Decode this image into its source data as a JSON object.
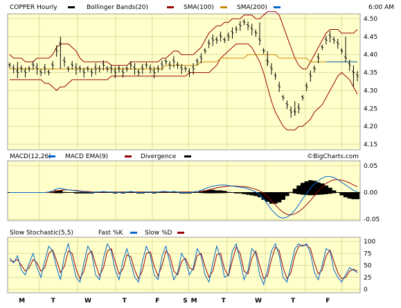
{
  "header": {
    "symbol_label": "COPPER Hourly",
    "bb_label": "Bollinger Bands(20)",
    "sma100_label": "SMA(100)",
    "sma200_label": "SMA(200)",
    "time_label": "6:00 AM"
  },
  "macd_header": {
    "macd_label": "MACD(12,26)",
    "ema_label": "MACD EMA(9)",
    "div_label": "Divergence",
    "watermark": "©BigCharts.com"
  },
  "stoch_header": {
    "title": "Slow Stochastic(5,5)",
    "fastk_label": "Fast %K",
    "slowd_label": "Slow %D"
  },
  "colors": {
    "panel_bg": "#ffffcc",
    "bb": "#990000",
    "sma100": "#cc8800",
    "sma200": "#0066cc",
    "macd": "#0066cc",
    "macd_ema": "#990000",
    "stoch_k": "#0066cc",
    "stoch_d": "#990000"
  },
  "chart_data": {
    "type": "stock_hourly_with_indicators",
    "x_day_labels": [
      "M",
      "T",
      "W",
      "T",
      "F",
      "S",
      "M",
      "T",
      "W",
      "T",
      "F"
    ],
    "price": {
      "ylim": [
        4.15,
        4.5
      ],
      "y_ticks": [
        "4.50",
        "4.45",
        "4.40",
        "4.35",
        "4.30",
        "4.25",
        "4.20",
        "4.15"
      ],
      "close": [
        4.37,
        4.36,
        4.35,
        4.36,
        4.35,
        4.36,
        4.37,
        4.36,
        4.35,
        4.36,
        4.35,
        4.37,
        4.41,
        4.43,
        4.38,
        4.36,
        4.37,
        4.36,
        4.36,
        4.35,
        4.36,
        4.35,
        4.36,
        4.36,
        4.37,
        4.36,
        4.36,
        4.35,
        4.36,
        4.35,
        4.36,
        4.37,
        4.36,
        4.35,
        4.36,
        4.37,
        4.36,
        4.35,
        4.36,
        4.37,
        4.38,
        4.37,
        4.38,
        4.37,
        4.36,
        4.36,
        4.35,
        4.36,
        4.38,
        4.39,
        4.41,
        4.43,
        4.44,
        4.44,
        4.45,
        4.44,
        4.45,
        4.46,
        4.47,
        4.48,
        4.49,
        4.48,
        4.47,
        4.46,
        4.44,
        4.41,
        4.38,
        4.36,
        4.34,
        4.31,
        4.28,
        4.26,
        4.24,
        4.24,
        4.25,
        4.28,
        4.31,
        4.34,
        4.36,
        4.39,
        4.42,
        4.44,
        4.45,
        4.44,
        4.43,
        4.41,
        4.39,
        4.37,
        4.35,
        4.34
      ],
      "bb_upper": [
        4.4,
        4.39,
        4.39,
        4.39,
        4.38,
        4.38,
        4.38,
        4.39,
        4.39,
        4.39,
        4.39,
        4.4,
        4.42,
        4.43,
        4.43,
        4.43,
        4.42,
        4.41,
        4.39,
        4.38,
        4.38,
        4.38,
        4.38,
        4.38,
        4.38,
        4.38,
        4.37,
        4.37,
        4.37,
        4.37,
        4.37,
        4.38,
        4.38,
        4.38,
        4.38,
        4.38,
        4.38,
        4.38,
        4.38,
        4.39,
        4.39,
        4.4,
        4.41,
        4.41,
        4.4,
        4.4,
        4.4,
        4.4,
        4.41,
        4.42,
        4.44,
        4.46,
        4.47,
        4.48,
        4.48,
        4.49,
        4.49,
        4.5,
        4.5,
        4.5,
        4.51,
        4.51,
        4.51,
        4.5,
        4.5,
        4.51,
        4.52,
        4.52,
        4.52,
        4.51,
        4.48,
        4.45,
        4.42,
        4.39,
        4.37,
        4.36,
        4.36,
        4.38,
        4.4,
        4.42,
        4.44,
        4.46,
        4.47,
        4.47,
        4.47,
        4.46,
        4.46,
        4.46,
        4.46,
        4.47
      ],
      "bb_lower": [
        4.33,
        4.33,
        4.33,
        4.33,
        4.33,
        4.33,
        4.33,
        4.33,
        4.33,
        4.32,
        4.32,
        4.31,
        4.3,
        4.31,
        4.31,
        4.32,
        4.33,
        4.33,
        4.33,
        4.33,
        4.33,
        4.33,
        4.33,
        4.33,
        4.33,
        4.33,
        4.34,
        4.34,
        4.34,
        4.34,
        4.34,
        4.34,
        4.34,
        4.34,
        4.34,
        4.34,
        4.34,
        4.34,
        4.34,
        4.34,
        4.34,
        4.34,
        4.34,
        4.34,
        4.34,
        4.34,
        4.35,
        4.35,
        4.35,
        4.35,
        4.35,
        4.35,
        4.36,
        4.37,
        4.39,
        4.4,
        4.41,
        4.42,
        4.43,
        4.43,
        4.43,
        4.43,
        4.42,
        4.4,
        4.38,
        4.35,
        4.31,
        4.27,
        4.24,
        4.22,
        4.2,
        4.19,
        4.19,
        4.19,
        4.2,
        4.2,
        4.21,
        4.22,
        4.24,
        4.25,
        4.26,
        4.28,
        4.3,
        4.32,
        4.34,
        4.35,
        4.34,
        4.33,
        4.31,
        4.29
      ],
      "sma100": [
        4.36,
        4.36,
        4.36,
        4.36,
        4.36,
        4.36,
        4.36,
        4.36,
        4.36,
        4.36,
        4.36,
        4.36,
        4.36,
        4.36,
        4.36,
        4.36,
        4.36,
        4.36,
        4.36,
        4.36,
        4.36,
        4.36,
        4.36,
        4.36,
        4.36,
        4.36,
        4.36,
        4.36,
        4.36,
        4.36,
        4.36,
        4.36,
        4.36,
        4.36,
        4.36,
        4.36,
        4.36,
        4.36,
        4.36,
        4.36,
        4.37,
        4.37,
        4.37,
        4.37,
        4.37,
        4.37,
        4.37,
        4.37,
        4.37,
        4.38,
        4.38,
        4.38,
        4.38,
        4.38,
        4.39,
        4.39,
        4.39,
        4.39,
        4.39,
        4.39,
        4.39,
        4.4,
        4.4,
        4.4,
        4.4,
        4.4,
        4.4,
        4.4,
        4.4,
        4.39,
        4.39,
        4.39,
        4.39,
        4.39,
        4.39,
        4.39,
        4.39,
        4.38,
        4.38,
        4.38,
        4.38,
        4.38,
        4.38,
        4.38,
        4.38,
        4.38,
        4.38,
        4.38,
        4.38,
        4.38
      ],
      "sma200_points": [
        [
          81,
          4.38
        ],
        [
          89,
          4.38
        ]
      ],
      "spikes": [
        [
          2,
          4.35,
          4.38
        ],
        [
          13,
          4.36,
          4.45
        ],
        [
          64,
          4.45,
          4.49
        ],
        [
          66,
          4.37,
          4.41
        ],
        [
          73,
          4.23,
          4.27
        ],
        [
          86,
          4.39,
          4.45
        ],
        [
          88,
          4.31,
          4.37
        ]
      ]
    },
    "macd": {
      "ylim": [
        -0.05,
        0.05
      ],
      "y_ticks": [
        "0.05",
        "0.00",
        "-0.05"
      ],
      "macd": [
        0,
        0,
        0,
        0,
        0,
        0,
        0,
        0,
        0,
        0,
        0.001,
        0.003,
        0.007,
        0.008,
        0.006,
        0.005,
        0.004,
        0.003,
        0.002,
        0.001,
        0.001,
        0,
        0.001,
        0.001,
        0.002,
        0.001,
        0.001,
        0,
        0.001,
        0,
        0.001,
        0.002,
        0.001,
        0,
        0,
        0.001,
        0.001,
        0,
        0.001,
        0.002,
        0.002,
        0.001,
        0.002,
        0.001,
        0,
        0,
        0,
        0.001,
        0.002,
        0.004,
        0.007,
        0.01,
        0.012,
        0.013,
        0.014,
        0.014,
        0.013,
        0.012,
        0.011,
        0.01,
        0.009,
        0.007,
        0.004,
        0.001,
        -0.004,
        -0.012,
        -0.022,
        -0.032,
        -0.04,
        -0.046,
        -0.048,
        -0.046,
        -0.041,
        -0.033,
        -0.023,
        -0.012,
        -0.002,
        0.008,
        0.016,
        0.022,
        0.027,
        0.03,
        0.03,
        0.028,
        0.024,
        0.019,
        0.014,
        0.009,
        0.004,
        0.001
      ],
      "macd_ema": [
        0,
        0,
        0,
        0,
        0,
        0,
        0,
        0,
        0,
        0,
        0,
        0.001,
        0.003,
        0.004,
        0.005,
        0.005,
        0.004,
        0.004,
        0.003,
        0.002,
        0.002,
        0.001,
        0.001,
        0.001,
        0.001,
        0.001,
        0.001,
        0.001,
        0.001,
        0.001,
        0.001,
        0.001,
        0.001,
        0.001,
        0.001,
        0.001,
        0.001,
        0.001,
        0.001,
        0.001,
        0.001,
        0.001,
        0.001,
        0.001,
        0.001,
        0.001,
        0.001,
        0.001,
        0.002,
        0.002,
        0.003,
        0.005,
        0.007,
        0.009,
        0.01,
        0.011,
        0.012,
        0.012,
        0.012,
        0.011,
        0.011,
        0.01,
        0.008,
        0.006,
        0.003,
        -0.001,
        -0.008,
        -0.015,
        -0.023,
        -0.031,
        -0.037,
        -0.041,
        -0.042,
        -0.04,
        -0.036,
        -0.03,
        -0.023,
        -0.015,
        -0.006,
        0.003,
        0.01,
        0.017,
        0.021,
        0.024,
        0.024,
        0.023,
        0.021,
        0.018,
        0.014,
        0.011
      ]
    },
    "stoch": {
      "ylim": [
        0,
        100
      ],
      "y_ticks": [
        "100",
        "75",
        "50",
        "25",
        "0"
      ],
      "fast_k": [
        65,
        55,
        70,
        40,
        30,
        55,
        75,
        45,
        25,
        60,
        90,
        80,
        45,
        20,
        70,
        95,
        60,
        25,
        15,
        55,
        90,
        75,
        30,
        20,
        65,
        95,
        80,
        40,
        20,
        60,
        85,
        55,
        25,
        15,
        60,
        90,
        70,
        30,
        20,
        70,
        90,
        55,
        20,
        35,
        75,
        60,
        30,
        45,
        85,
        70,
        30,
        15,
        55,
        90,
        65,
        25,
        30,
        80,
        95,
        60,
        20,
        40,
        85,
        75,
        30,
        10,
        40,
        80,
        95,
        70,
        25,
        15,
        50,
        85,
        95,
        90,
        95,
        75,
        35,
        20,
        50,
        85,
        80,
        40,
        25,
        15,
        30,
        45,
        40,
        35
      ],
      "slow_d": [
        60,
        58,
        62,
        50,
        38,
        45,
        62,
        55,
        38,
        45,
        75,
        82,
        60,
        35,
        48,
        80,
        75,
        42,
        22,
        38,
        72,
        80,
        52,
        28,
        45,
        80,
        85,
        58,
        32,
        42,
        72,
        68,
        40,
        22,
        40,
        75,
        78,
        48,
        28,
        50,
        80,
        70,
        38,
        30,
        58,
        65,
        45,
        40,
        70,
        75,
        48,
        25,
        38,
        72,
        75,
        42,
        28,
        60,
        88,
        75,
        38,
        32,
        65,
        80,
        50,
        22,
        28,
        62,
        88,
        80,
        45,
        22,
        35,
        70,
        90,
        92,
        92,
        85,
        55,
        32,
        40,
        70,
        82,
        58,
        35,
        22,
        25,
        38,
        42,
        38
      ]
    }
  }
}
